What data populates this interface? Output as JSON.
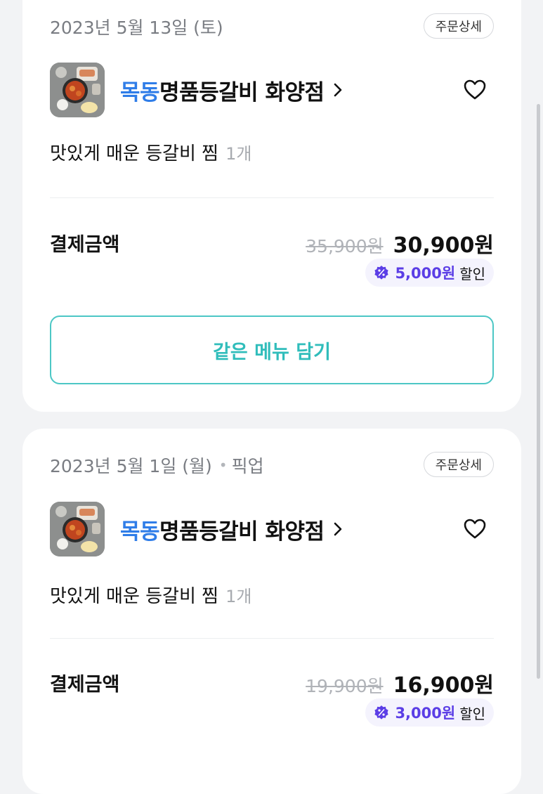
{
  "orders": [
    {
      "date": "2023년 5월 13일 (토)",
      "order_type": "",
      "detail_label": "주문상세",
      "store_name_highlight": "목동",
      "store_name_rest": "명품등갈비 화양점",
      "menu_item": "맛있게 매운 등갈비 찜",
      "menu_qty": "1개",
      "payment_label": "결제금액",
      "original_price": "35,900원",
      "final_price": "30,900원",
      "discount_amount": "5,000원",
      "discount_label": "할인",
      "reorder_label": "같은 메뉴 담기"
    },
    {
      "date": "2023년 5월 1일 (월)",
      "order_type": "픽업",
      "detail_label": "주문상세",
      "store_name_highlight": "목동",
      "store_name_rest": "명품등갈비 화양점",
      "menu_item": "맛있게 매운 등갈비 찜",
      "menu_qty": "1개",
      "payment_label": "결제금액",
      "original_price": "19,900원",
      "final_price": "16,900원",
      "discount_amount": "3,000원",
      "discount_label": "할인"
    }
  ],
  "icons": {
    "heart": "heart-icon",
    "chevron": "chevron-right-icon",
    "discount": "discount-badge-icon"
  },
  "colors": {
    "background": "#f2f3f5",
    "card": "#ffffff",
    "store_highlight": "#2f7de8",
    "discount_purple": "#5b3ee6",
    "reorder_teal": "#30bdbb"
  }
}
